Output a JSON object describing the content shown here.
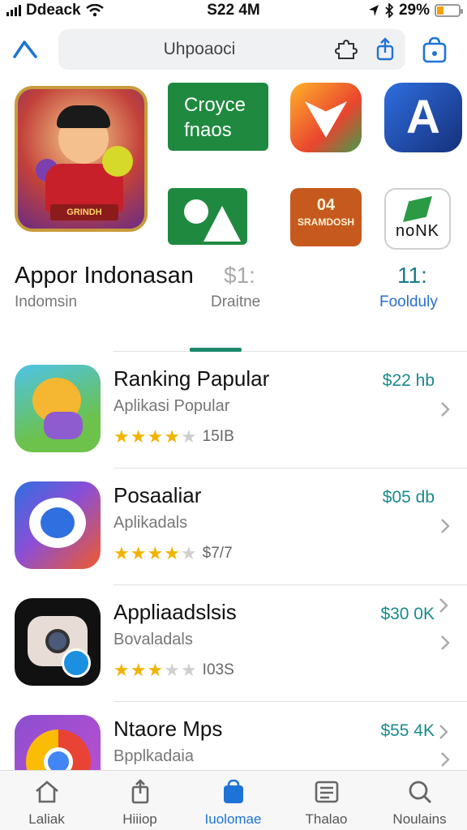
{
  "status_bar": {
    "carrier": "Ddeack",
    "time": "S22 4M",
    "battery": "29%",
    "battery_level": 0.29
  },
  "search": {
    "placeholder": "Uhpoaoci"
  },
  "featured": {
    "tile_green_line1": "Croyce",
    "tile_green_line2": "fnaos",
    "tile_orange_line1": "04",
    "tile_orange_line2": "SRAMDOSH",
    "tile_white_text": "noNK",
    "tile_a_letter": "A",
    "main_banner": "GRINDH",
    "title": "Appor Indonasan",
    "subtitle": "Indomsin",
    "price": "$1:",
    "price_label": "Draitne",
    "count": "11:",
    "count_label": "Foolduly"
  },
  "apps": [
    {
      "title": "Ranking Papular",
      "subtitle": "Aplikasi Popular",
      "rating": 3.5,
      "count": "15IB",
      "price": "$22 hb"
    },
    {
      "title": "Posaaliar",
      "subtitle": "Aplikadals",
      "rating": 3.5,
      "count": "$7/7",
      "price": "$05 db"
    },
    {
      "title": "Appliaadslsis",
      "subtitle": "Bovaladals",
      "rating": 3,
      "count": "I03S",
      "price": "$30 0K"
    },
    {
      "title": "Ntaore Mps",
      "subtitle": "Bpplkadaia",
      "rating": 0,
      "count": "",
      "price": "$55 4K"
    }
  ],
  "tabs": [
    {
      "label": "Laliak",
      "icon": "home-icon"
    },
    {
      "label": "Hiiiop",
      "icon": "share-icon"
    },
    {
      "label": "Iuolomae",
      "icon": "apps-icon"
    },
    {
      "label": "Thalao",
      "icon": "news-icon"
    },
    {
      "label": "Noulains",
      "icon": "search-icon"
    }
  ],
  "colors": {
    "accent": "#1e73d6",
    "price_teal": "#1a8a8a",
    "star": "#f0b400",
    "tile_green": "#1f8a3f"
  }
}
